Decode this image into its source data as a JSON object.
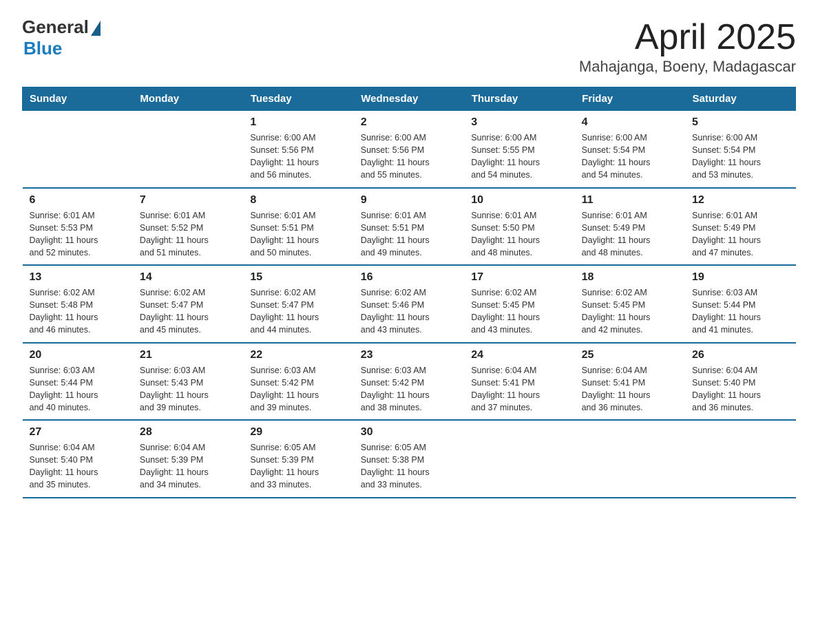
{
  "logo": {
    "general": "General",
    "blue": "Blue"
  },
  "title": "April 2025",
  "subtitle": "Mahajanga, Boeny, Madagascar",
  "headers": [
    "Sunday",
    "Monday",
    "Tuesday",
    "Wednesday",
    "Thursday",
    "Friday",
    "Saturday"
  ],
  "weeks": [
    [
      {
        "day": "",
        "info": ""
      },
      {
        "day": "",
        "info": ""
      },
      {
        "day": "1",
        "info": "Sunrise: 6:00 AM\nSunset: 5:56 PM\nDaylight: 11 hours\nand 56 minutes."
      },
      {
        "day": "2",
        "info": "Sunrise: 6:00 AM\nSunset: 5:56 PM\nDaylight: 11 hours\nand 55 minutes."
      },
      {
        "day": "3",
        "info": "Sunrise: 6:00 AM\nSunset: 5:55 PM\nDaylight: 11 hours\nand 54 minutes."
      },
      {
        "day": "4",
        "info": "Sunrise: 6:00 AM\nSunset: 5:54 PM\nDaylight: 11 hours\nand 54 minutes."
      },
      {
        "day": "5",
        "info": "Sunrise: 6:00 AM\nSunset: 5:54 PM\nDaylight: 11 hours\nand 53 minutes."
      }
    ],
    [
      {
        "day": "6",
        "info": "Sunrise: 6:01 AM\nSunset: 5:53 PM\nDaylight: 11 hours\nand 52 minutes."
      },
      {
        "day": "7",
        "info": "Sunrise: 6:01 AM\nSunset: 5:52 PM\nDaylight: 11 hours\nand 51 minutes."
      },
      {
        "day": "8",
        "info": "Sunrise: 6:01 AM\nSunset: 5:51 PM\nDaylight: 11 hours\nand 50 minutes."
      },
      {
        "day": "9",
        "info": "Sunrise: 6:01 AM\nSunset: 5:51 PM\nDaylight: 11 hours\nand 49 minutes."
      },
      {
        "day": "10",
        "info": "Sunrise: 6:01 AM\nSunset: 5:50 PM\nDaylight: 11 hours\nand 48 minutes."
      },
      {
        "day": "11",
        "info": "Sunrise: 6:01 AM\nSunset: 5:49 PM\nDaylight: 11 hours\nand 48 minutes."
      },
      {
        "day": "12",
        "info": "Sunrise: 6:01 AM\nSunset: 5:49 PM\nDaylight: 11 hours\nand 47 minutes."
      }
    ],
    [
      {
        "day": "13",
        "info": "Sunrise: 6:02 AM\nSunset: 5:48 PM\nDaylight: 11 hours\nand 46 minutes."
      },
      {
        "day": "14",
        "info": "Sunrise: 6:02 AM\nSunset: 5:47 PM\nDaylight: 11 hours\nand 45 minutes."
      },
      {
        "day": "15",
        "info": "Sunrise: 6:02 AM\nSunset: 5:47 PM\nDaylight: 11 hours\nand 44 minutes."
      },
      {
        "day": "16",
        "info": "Sunrise: 6:02 AM\nSunset: 5:46 PM\nDaylight: 11 hours\nand 43 minutes."
      },
      {
        "day": "17",
        "info": "Sunrise: 6:02 AM\nSunset: 5:45 PM\nDaylight: 11 hours\nand 43 minutes."
      },
      {
        "day": "18",
        "info": "Sunrise: 6:02 AM\nSunset: 5:45 PM\nDaylight: 11 hours\nand 42 minutes."
      },
      {
        "day": "19",
        "info": "Sunrise: 6:03 AM\nSunset: 5:44 PM\nDaylight: 11 hours\nand 41 minutes."
      }
    ],
    [
      {
        "day": "20",
        "info": "Sunrise: 6:03 AM\nSunset: 5:44 PM\nDaylight: 11 hours\nand 40 minutes."
      },
      {
        "day": "21",
        "info": "Sunrise: 6:03 AM\nSunset: 5:43 PM\nDaylight: 11 hours\nand 39 minutes."
      },
      {
        "day": "22",
        "info": "Sunrise: 6:03 AM\nSunset: 5:42 PM\nDaylight: 11 hours\nand 39 minutes."
      },
      {
        "day": "23",
        "info": "Sunrise: 6:03 AM\nSunset: 5:42 PM\nDaylight: 11 hours\nand 38 minutes."
      },
      {
        "day": "24",
        "info": "Sunrise: 6:04 AM\nSunset: 5:41 PM\nDaylight: 11 hours\nand 37 minutes."
      },
      {
        "day": "25",
        "info": "Sunrise: 6:04 AM\nSunset: 5:41 PM\nDaylight: 11 hours\nand 36 minutes."
      },
      {
        "day": "26",
        "info": "Sunrise: 6:04 AM\nSunset: 5:40 PM\nDaylight: 11 hours\nand 36 minutes."
      }
    ],
    [
      {
        "day": "27",
        "info": "Sunrise: 6:04 AM\nSunset: 5:40 PM\nDaylight: 11 hours\nand 35 minutes."
      },
      {
        "day": "28",
        "info": "Sunrise: 6:04 AM\nSunset: 5:39 PM\nDaylight: 11 hours\nand 34 minutes."
      },
      {
        "day": "29",
        "info": "Sunrise: 6:05 AM\nSunset: 5:39 PM\nDaylight: 11 hours\nand 33 minutes."
      },
      {
        "day": "30",
        "info": "Sunrise: 6:05 AM\nSunset: 5:38 PM\nDaylight: 11 hours\nand 33 minutes."
      },
      {
        "day": "",
        "info": ""
      },
      {
        "day": "",
        "info": ""
      },
      {
        "day": "",
        "info": ""
      }
    ]
  ]
}
